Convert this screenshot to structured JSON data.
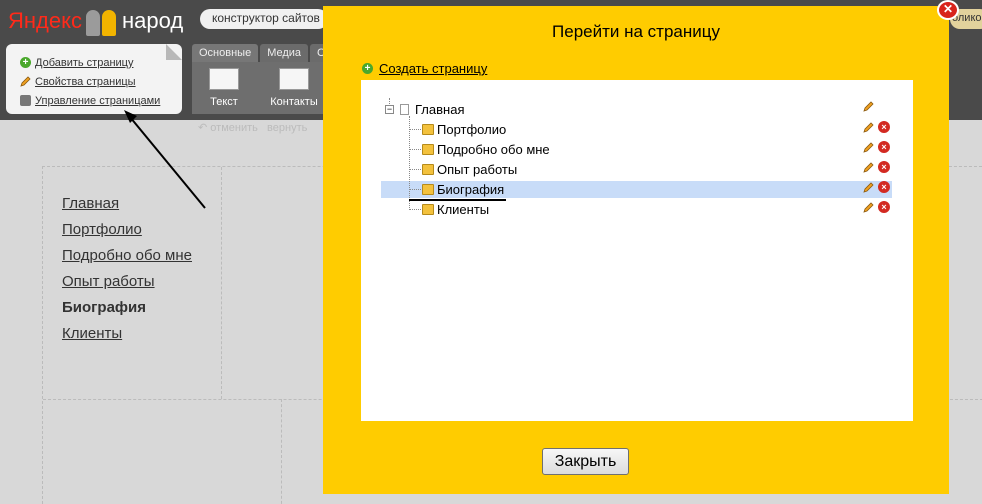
{
  "header": {
    "logo_part1": "Яндекс",
    "logo_part2": "народ",
    "site_builder_label": "конструктор сайтов",
    "right_pill_label": "олико"
  },
  "page_panel": {
    "items": [
      {
        "label": "Добавить страницу",
        "icon": "add-icon"
      },
      {
        "label": "Свойства страницы",
        "icon": "pencil-icon"
      },
      {
        "label": "Управление страницами",
        "icon": "settings-icon"
      }
    ]
  },
  "toolbar": {
    "tabs": [
      "Основные",
      "Медиа",
      "С"
    ],
    "tools": [
      {
        "label": "Текст",
        "icon": "text-block-icon"
      },
      {
        "label": "Контакты",
        "icon": "contacts-icon"
      }
    ],
    "undo_label": "отменить",
    "redo_label": "вернуть"
  },
  "site_nav": {
    "items": [
      "Главная",
      "Портфолио",
      "Подробно обо мне",
      "Опыт работы",
      "Биография",
      "Клиенты"
    ],
    "active": "Биография"
  },
  "dialog": {
    "title": "Перейти на страницу",
    "create_label": "Создать страницу",
    "tree": {
      "root": "Главная",
      "children": [
        "Портфолио",
        "Подробно обо мне",
        "Опыт работы",
        "Биография",
        "Клиенты"
      ],
      "selected": "Биография"
    },
    "close_button": "Закрыть"
  },
  "colors": {
    "dialog_bg": "#ffcc00",
    "selection": "#c8dcf8",
    "delete_icon": "#d32a22",
    "add_icon": "#4aa82b"
  }
}
